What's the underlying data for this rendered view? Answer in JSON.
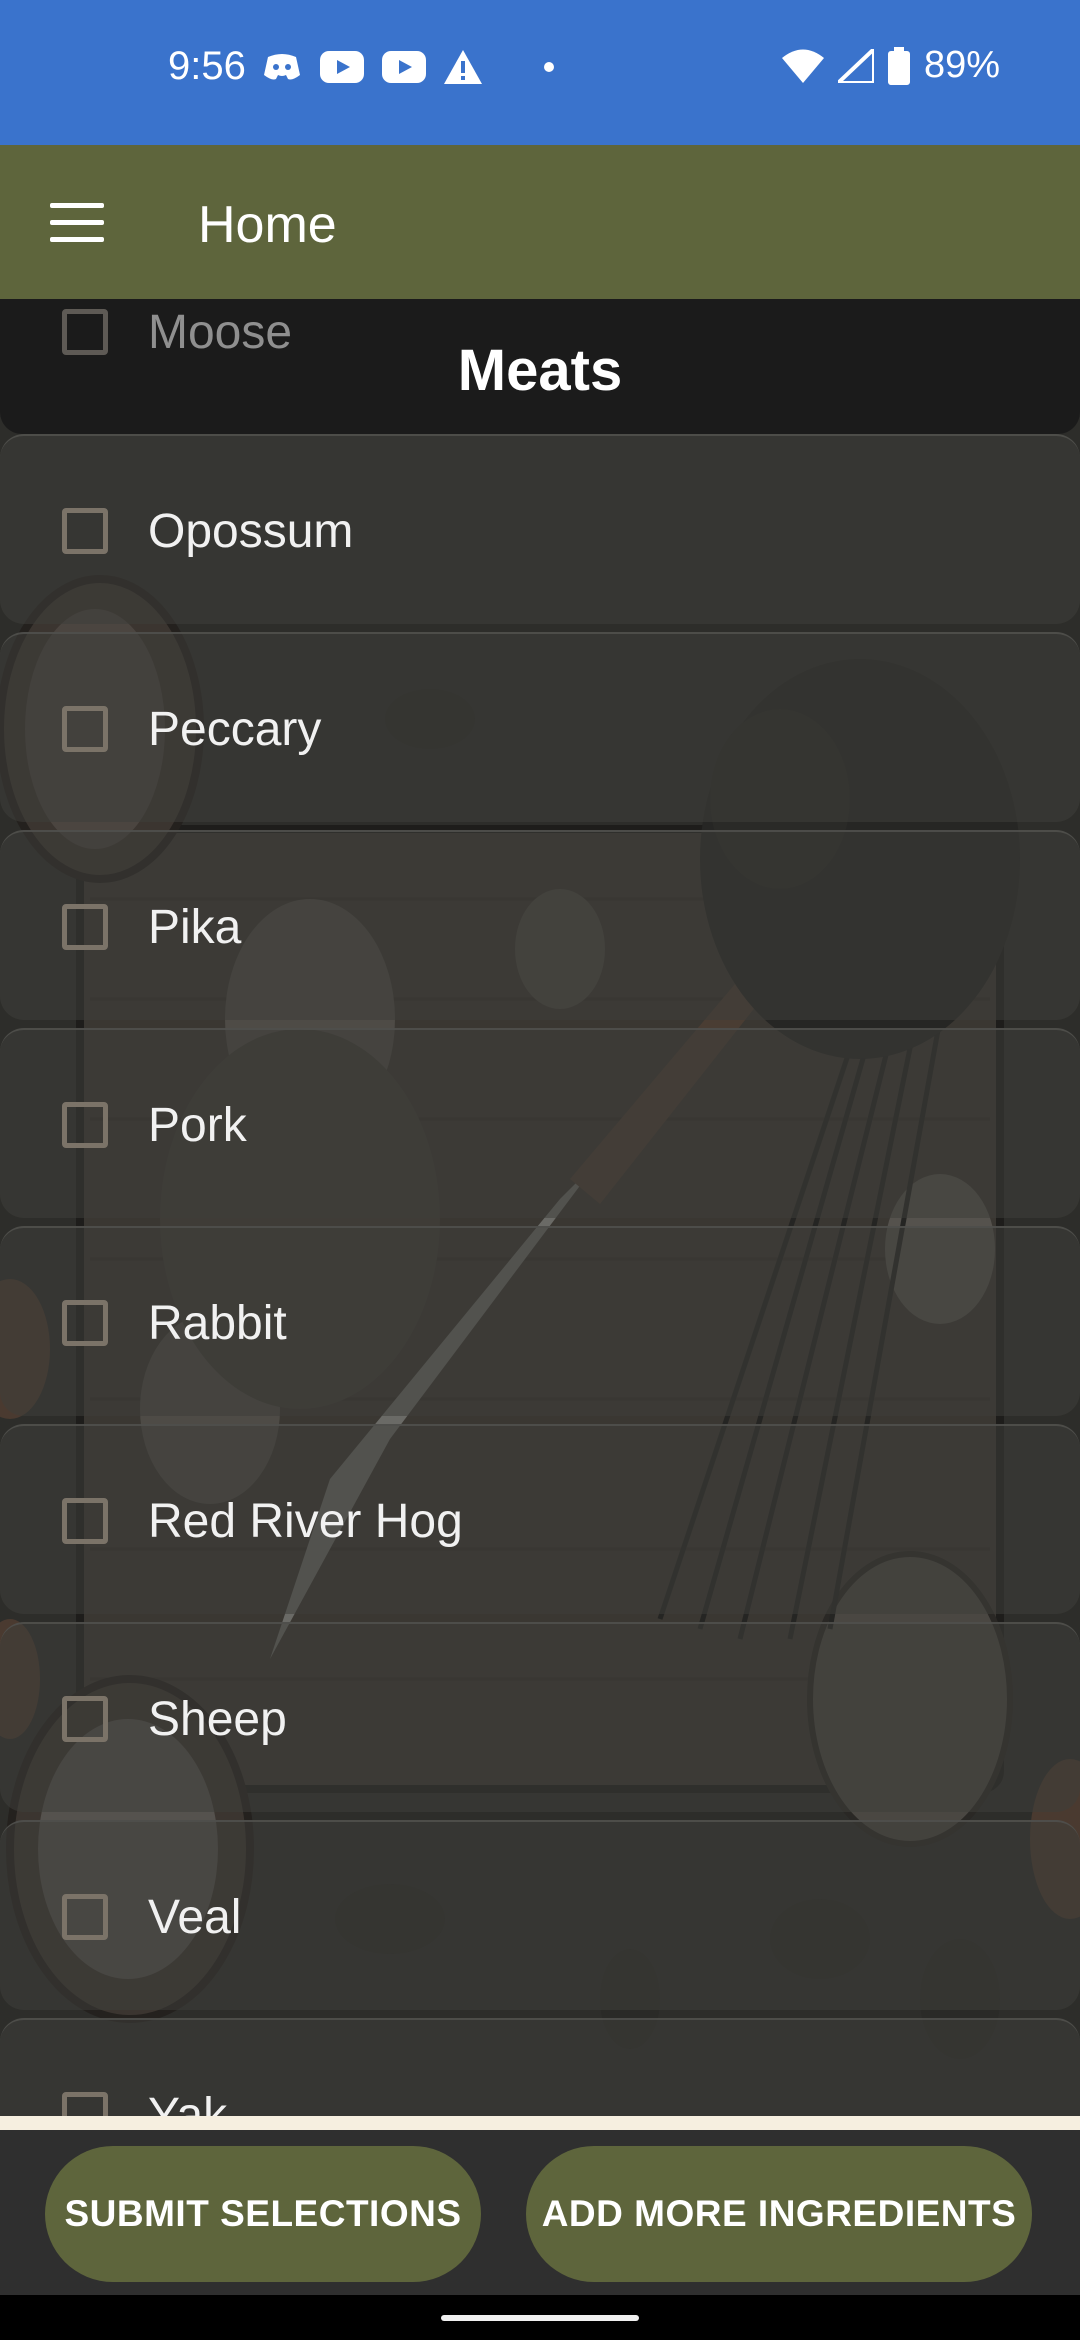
{
  "status_bar": {
    "time": "9:56",
    "battery": "89%",
    "icons_left": [
      "discord-icon",
      "youtube-icon",
      "youtube-icon",
      "warning-icon",
      "dot-icon"
    ],
    "icons_right": [
      "wifi-icon",
      "cellular-signal-icon",
      "battery-icon"
    ]
  },
  "app_bar": {
    "title": "Home",
    "menu_icon": "hamburger-menu-icon",
    "color": "#5e653c"
  },
  "section": {
    "title": "Meats",
    "partially_hidden_item": "Moose"
  },
  "items": [
    {
      "label": "Opossum",
      "checked": false
    },
    {
      "label": "Peccary",
      "checked": false
    },
    {
      "label": "Pika",
      "checked": false
    },
    {
      "label": "Pork",
      "checked": false
    },
    {
      "label": "Rabbit",
      "checked": false
    },
    {
      "label": "Red River Hog",
      "checked": false
    },
    {
      "label": "Sheep",
      "checked": false
    },
    {
      "label": "Veal",
      "checked": false
    },
    {
      "label": "Yak",
      "checked": false
    }
  ],
  "actions": {
    "submit": "SUBMIT SELECTIONS",
    "add_more": "ADD MORE INGREDIENTS"
  },
  "colors": {
    "status_bar": "#3a73cc",
    "accent": "#5e653c",
    "header": "#1b1b1b"
  }
}
